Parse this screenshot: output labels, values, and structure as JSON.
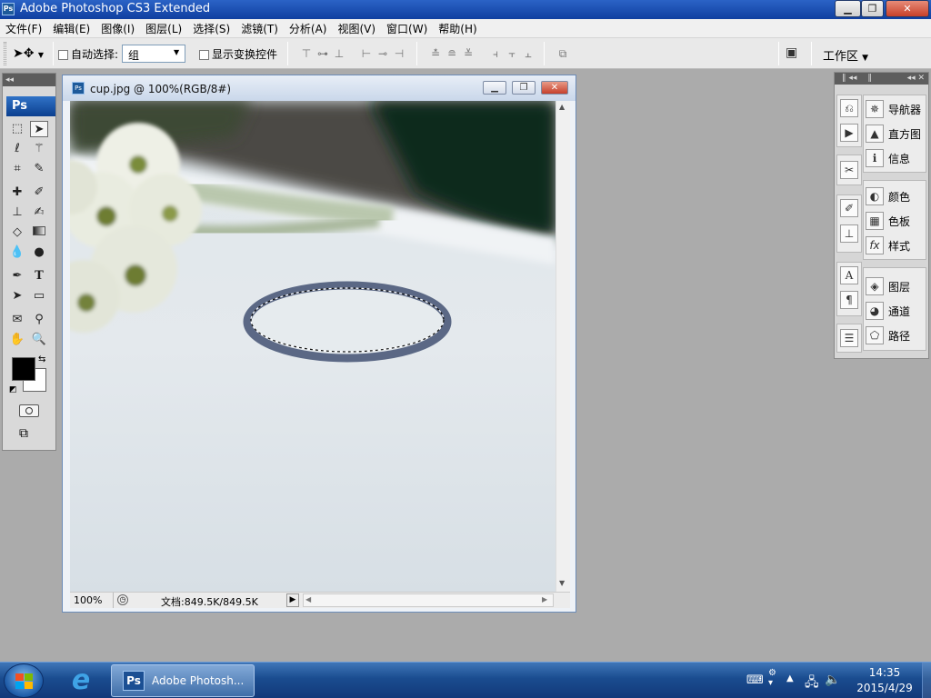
{
  "app": {
    "title": "Adobe Photoshop CS3 Extended",
    "icon": "Ps"
  },
  "menu": [
    "文件(F)",
    "编辑(E)",
    "图像(I)",
    "图层(L)",
    "选择(S)",
    "滤镜(T)",
    "分析(A)",
    "视图(V)",
    "窗口(W)",
    "帮助(H)"
  ],
  "options": {
    "auto_select_label": "自动选择:",
    "auto_select_value": "组",
    "show_transform_label": "显示变换控件",
    "workspace_label": "工作区"
  },
  "tools": {
    "ps_label": "Ps"
  },
  "document": {
    "title": "cup.jpg @ 100%(RGB/8#)",
    "zoom": "100%",
    "doc_size": "文档:849.5K/849.5K"
  },
  "panels": {
    "group1": [
      "导航器",
      "直方图",
      "信息"
    ],
    "group2": [
      "颜色",
      "色板",
      "样式"
    ],
    "group3": [
      "图层",
      "通道",
      "路径"
    ]
  },
  "taskbar": {
    "ps_button": "Adobe Photosh...",
    "time": "14:35",
    "date": "2015/4/29"
  },
  "colors": {
    "foreground": "#000000",
    "background": "#ffffff",
    "selection_ring": "#55627e"
  }
}
